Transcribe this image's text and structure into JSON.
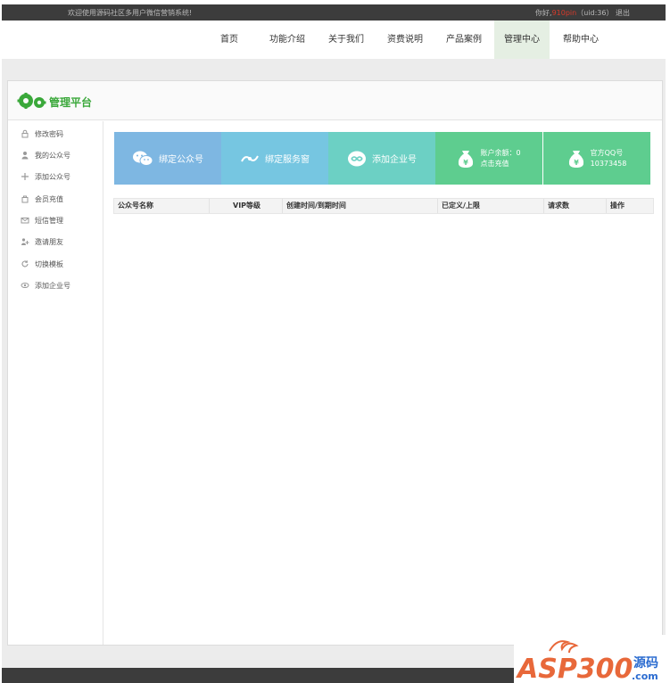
{
  "topbar": {
    "welcome": "欢迎使用源码社区多用户微信营销系统!",
    "greeting_prefix": "你好,",
    "username": "910pin",
    "uid": "（uid:36）",
    "logout": "退出"
  },
  "nav": {
    "items": [
      {
        "label": "首页"
      },
      {
        "label": "功能介绍"
      },
      {
        "label": "关于我们"
      },
      {
        "label": "资费说明"
      },
      {
        "label": "产品案例"
      },
      {
        "label": "管理中心"
      },
      {
        "label": "帮助中心"
      }
    ],
    "active_index": 5
  },
  "panel": {
    "title": "管理平台"
  },
  "sidebar": {
    "items": [
      {
        "label": "修改密码",
        "icon": "lock-icon"
      },
      {
        "label": "我的公众号",
        "icon": "user-icon"
      },
      {
        "label": "添加公众号",
        "icon": "plus-icon"
      },
      {
        "label": "会员充值",
        "icon": "bag-icon"
      },
      {
        "label": "短信管理",
        "icon": "mail-icon"
      },
      {
        "label": "邀请朋友",
        "icon": "invite-icon"
      },
      {
        "label": "切换模板",
        "icon": "refresh-icon"
      },
      {
        "label": "添加企业号",
        "icon": "eye-icon"
      }
    ]
  },
  "tiles": [
    {
      "label": "绑定公众号",
      "icon": "wechat-icon",
      "color": "#7eb7e2"
    },
    {
      "label": "绑定服务窗",
      "icon": "alipay-icon",
      "color": "#76c6e1"
    },
    {
      "label": "添加企业号",
      "icon": "enterprise-icon",
      "color": "#6cd0c4"
    },
    {
      "line1": "账户余额：0",
      "line2": "点击充值",
      "icon": "money-bag-icon",
      "color": "#5ecd8f"
    },
    {
      "line1": "官方QQ号",
      "line2": "10373458",
      "icon": "money-bag-icon",
      "color": "#5ecd8f"
    }
  ],
  "table": {
    "columns": [
      "公众号名称",
      "VIP等级",
      "创建时间/到期时间",
      "已定义/上限",
      "请求数",
      "操作"
    ]
  },
  "watermark": {
    "brand": "ASP300",
    "suffix": "源码",
    "domain": ".com"
  }
}
